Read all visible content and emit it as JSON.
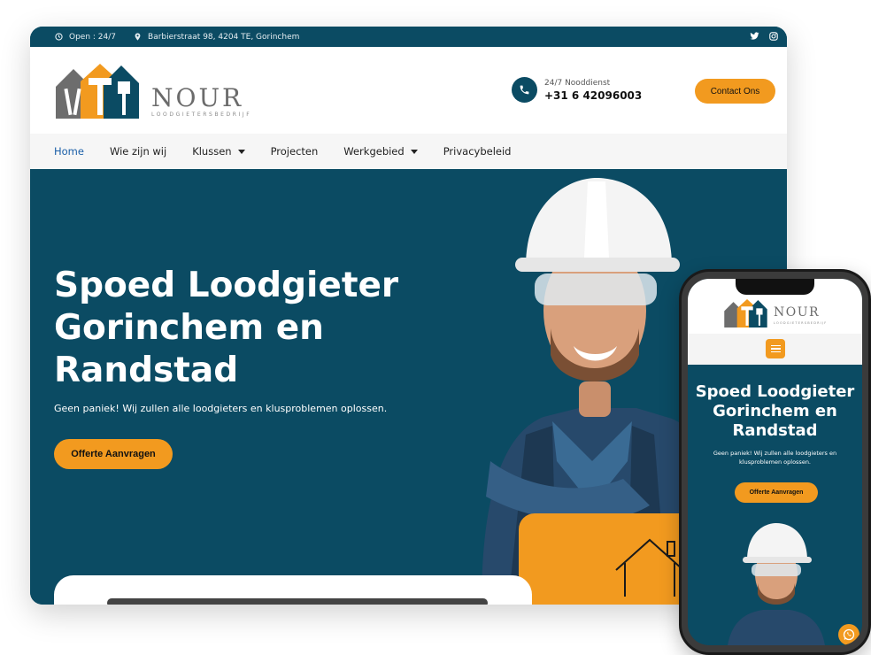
{
  "topbar": {
    "open": "Open : 24/7",
    "address": "Barbierstraat 98, 4204 TE, Gorinchem"
  },
  "logo": {
    "name": "NOUR",
    "tagline": "LOODGIETERSBEDRIJF"
  },
  "call": {
    "label": "24/7 Nooddienst",
    "number": "+31 6 42096003"
  },
  "contact_button": "Contact Ons",
  "nav": {
    "home": "Home",
    "about": "Wie zijn wij",
    "jobs": "Klussen",
    "projects": "Projecten",
    "area": "Werkgebied",
    "privacy": "Privacybeleid"
  },
  "hero": {
    "title": "Spoed Loodgieter Gorinchem en Randstad",
    "subtitle": "Geen paniek! Wij zullen alle loodgieters en klusproblemen oplossen.",
    "button": "Offerte Aanvragen"
  },
  "mobile": {
    "title": "Spoed Loodgieter Gorinchem en Randstad",
    "subtitle": "Geen paniek! Wij zullen alle loodgieters en klusproblemen oplossen.",
    "button": "Offerte Aanvragen"
  },
  "colors": {
    "navy": "#0b4b63",
    "orange": "#f29a1f",
    "nav_active": "#1b5fa8"
  }
}
